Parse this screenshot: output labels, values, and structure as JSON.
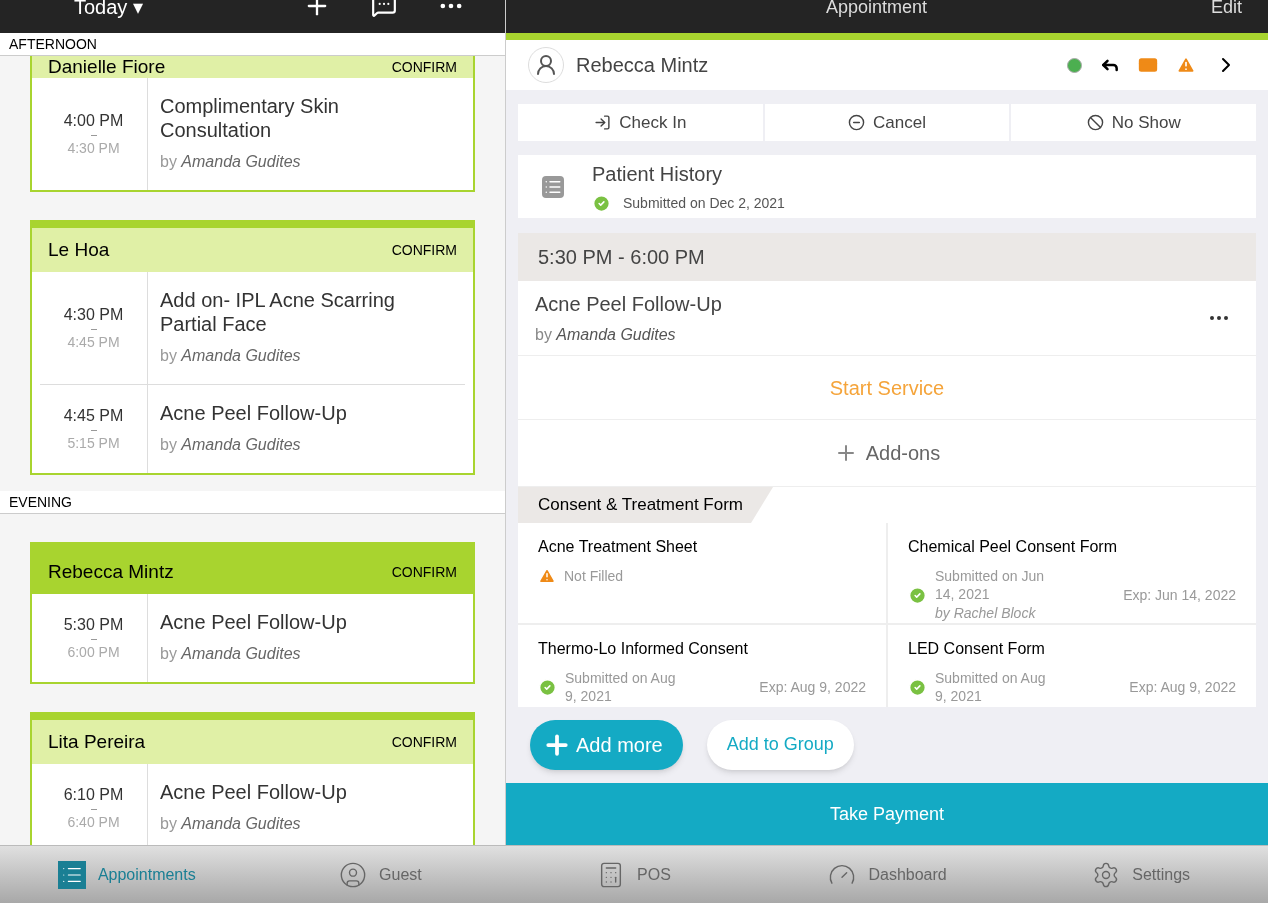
{
  "left_header": {
    "title": "Today ▾"
  },
  "sections": [
    {
      "label": "AFTERNOON",
      "cards": [
        {
          "client": "Danielle Fiore",
          "action": "CONFIRM",
          "selected": false,
          "clipped": true,
          "services": [
            {
              "start": "4:00 PM",
              "end": "4:30 PM",
              "name": "Complimentary Skin Consultation",
              "by": "by",
              "provider": "Amanda Gudites"
            }
          ]
        },
        {
          "client": "Le Hoa",
          "action": "CONFIRM",
          "selected": false,
          "clipped": false,
          "services": [
            {
              "start": "4:30 PM",
              "end": "4:45 PM",
              "name": "Add on- IPL Acne Scarring Partial Face",
              "by": "by",
              "provider": "Amanda Gudites"
            },
            {
              "start": "4:45 PM",
              "end": "5:15 PM",
              "name": "Acne Peel Follow-Up",
              "by": "by",
              "provider": "Amanda Gudites"
            }
          ]
        }
      ]
    },
    {
      "label": "EVENING",
      "cards": [
        {
          "client": "Rebecca Mintz",
          "action": "CONFIRM",
          "selected": true,
          "clipped": false,
          "services": [
            {
              "start": "5:30 PM",
              "end": "6:00 PM",
              "name": "Acne Peel Follow-Up",
              "by": "by",
              "provider": "Amanda Gudites"
            }
          ]
        },
        {
          "client": "Lita Pereira",
          "action": "CONFIRM",
          "selected": false,
          "clipped": false,
          "services": [
            {
              "start": "6:10 PM",
              "end": "6:40 PM",
              "name": "Acne Peel Follow-Up",
              "by": "by",
              "provider": "Amanda Gudites"
            }
          ]
        }
      ]
    }
  ],
  "appointment": {
    "title": "Appointment",
    "edit": "Edit",
    "client": "Rebecca Mintz",
    "actions": [
      {
        "kind": "checkin",
        "label": "Check In"
      },
      {
        "kind": "cancel",
        "label": "Cancel"
      },
      {
        "kind": "noshow",
        "label": "No Show"
      }
    ],
    "history": {
      "title": "Patient History",
      "status": "Submitted on Dec 2, 2021"
    },
    "time": "5:30 PM - 6:00 PM",
    "service": {
      "name": "Acne Peel Follow-Up",
      "by": "by",
      "provider": "Amanda Gudites"
    },
    "start_service": "Start Service",
    "addons": "Add-ons",
    "forms_title": "Consent & Treatment Form",
    "forms": [
      {
        "name": "Acne Treatment Sheet",
        "filled": false,
        "status": "Not Filled"
      },
      {
        "name": "Chemical Peel Consent Form",
        "filled": true,
        "status": "Submitted on Jun 14, 2021",
        "by": "by Rachel Block",
        "exp": "Exp: Jun 14, 2022"
      },
      {
        "name": "Thermo-Lo Informed Consent",
        "filled": true,
        "status": "Submitted on Aug 9, 2021",
        "exp": "Exp: Aug 9, 2022"
      },
      {
        "name": "LED Consent Form",
        "filled": true,
        "status": "Submitted on Aug 9, 2021",
        "exp": "Exp: Aug 9, 2022"
      }
    ],
    "add_more": "Add more",
    "add_group": "Add to Group",
    "payment": "Take Payment"
  },
  "tabs": [
    {
      "kind": "appointments",
      "label": "Appointments",
      "selected": true
    },
    {
      "kind": "guest",
      "label": "Guest",
      "selected": false
    },
    {
      "kind": "pos",
      "label": "POS",
      "selected": false
    },
    {
      "kind": "dashboard",
      "label": "Dashboard",
      "selected": false
    },
    {
      "kind": "settings",
      "label": "Settings",
      "selected": false
    }
  ]
}
